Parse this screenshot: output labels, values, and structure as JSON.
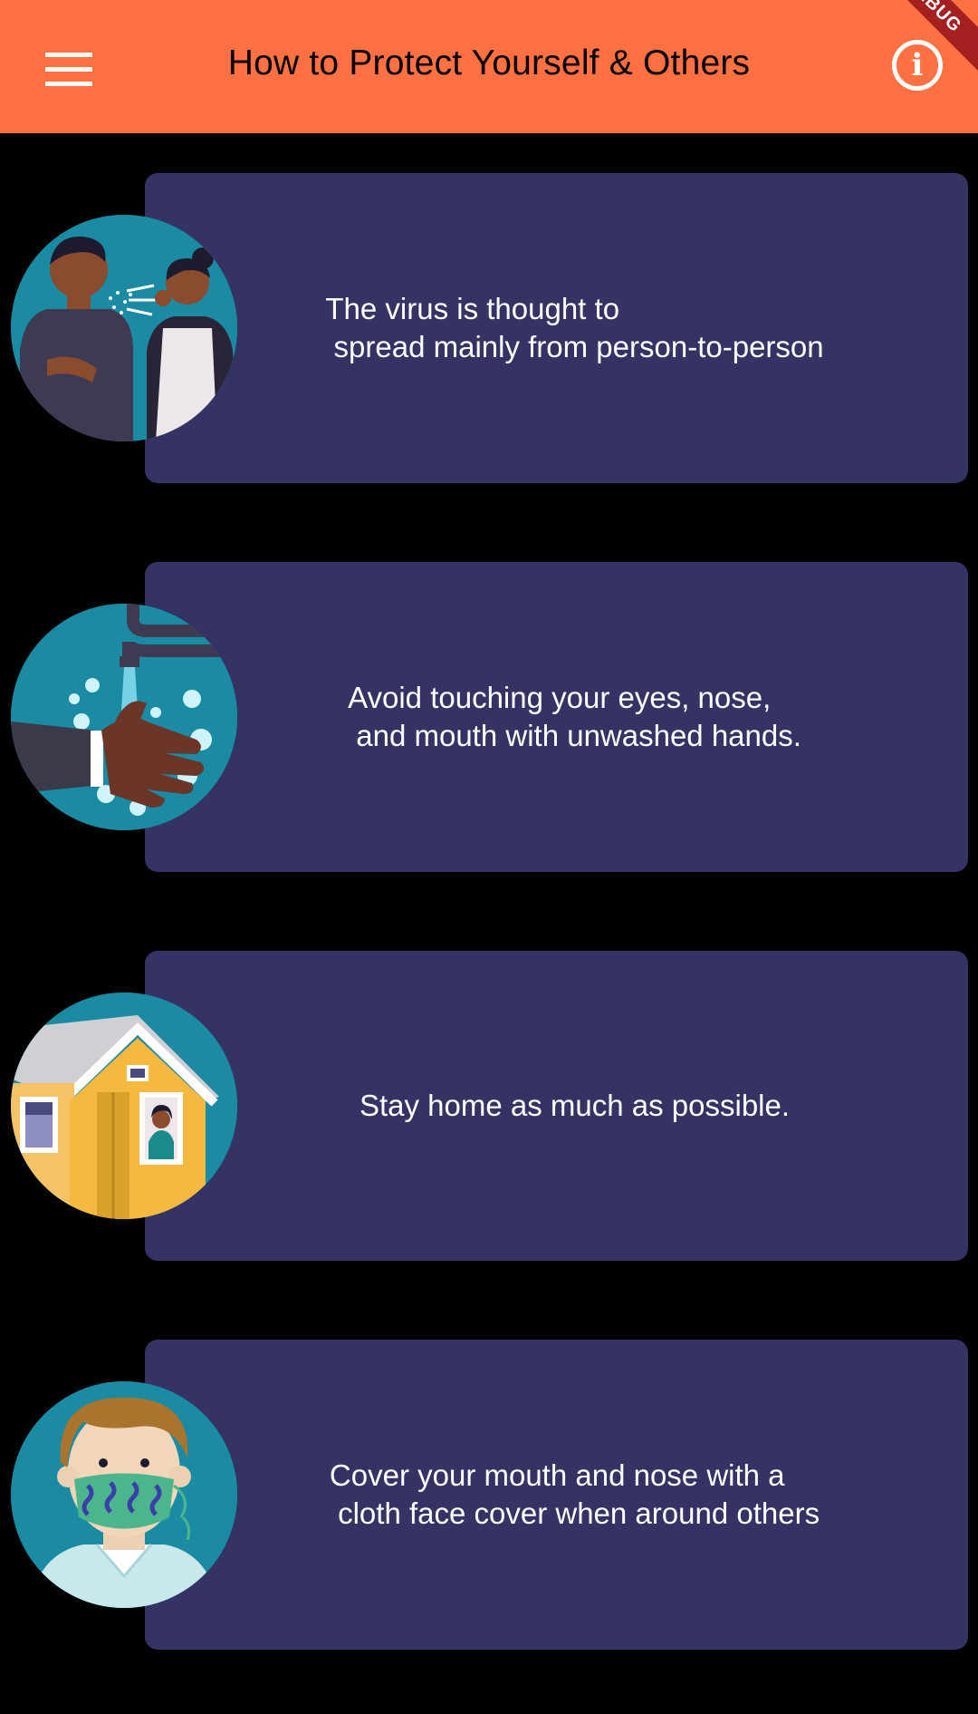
{
  "appbar": {
    "title": "How to Protect Yourself & Others",
    "menu_icon": "hamburger-menu-icon",
    "info_icon": "info-circle-icon",
    "info_glyph": "i",
    "debug_label": "DEBUG",
    "background_color": "#FF7043"
  },
  "cards": [
    {
      "text": "The virus is thought to\n spread mainly from person-to-person",
      "illustration": "people-coughing-illustration"
    },
    {
      "text": "Avoid touching your eyes, nose,\n and mouth with unwashed hands.",
      "illustration": "hand-washing-illustration"
    },
    {
      "text": "Stay home as much as possible.",
      "illustration": "stay-home-illustration"
    },
    {
      "text": "Cover your mouth and nose with a\n cloth face cover when around others",
      "illustration": "face-mask-illustration"
    }
  ],
  "colors": {
    "card_background": "#343364",
    "page_background": "#000000",
    "illustration_background": "#1A8BA3"
  }
}
